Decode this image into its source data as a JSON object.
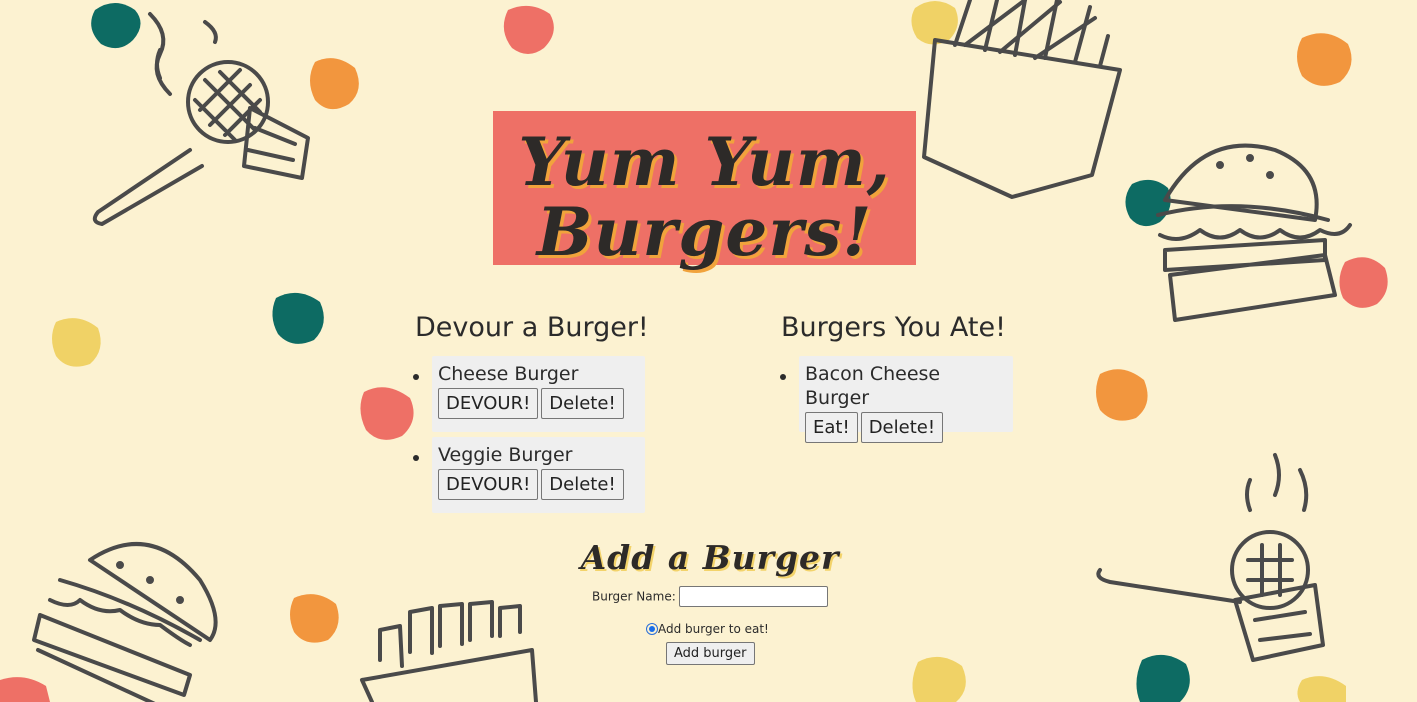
{
  "header": {
    "title_line1": "Yum Yum,",
    "title_line2": "Burgers!"
  },
  "devour": {
    "title": "Devour a Burger!",
    "items": [
      {
        "name": "Cheese Burger",
        "action_label": "DEVOUR!",
        "delete_label": "Delete!"
      },
      {
        "name": "Veggie Burger",
        "action_label": "DEVOUR!",
        "delete_label": "Delete!"
      }
    ]
  },
  "eaten": {
    "title": "Burgers You Ate!",
    "items": [
      {
        "name": "Bacon Cheese Burger",
        "action_label": "Eat!",
        "delete_label": "Delete!"
      }
    ]
  },
  "add_form": {
    "title": "Add a Burger",
    "name_label": "Burger Name:",
    "name_value": "",
    "radio_label": "Add burger to eat!",
    "radio_checked": true,
    "submit_label": "Add burger"
  },
  "colors": {
    "background": "#fcf2d1",
    "banner": "#ee7066",
    "accent_orange": "#f1a33c",
    "teal_blob": "#0d6b63",
    "yellow_blob": "#f0d266",
    "orange_blob": "#f2963e",
    "red_blob": "#ee7066",
    "sketch_stroke": "#4a4a4a"
  },
  "decorations": [
    "spatula-patty-icon",
    "fries-icon",
    "hamburger-icon",
    "paint-blob"
  ]
}
